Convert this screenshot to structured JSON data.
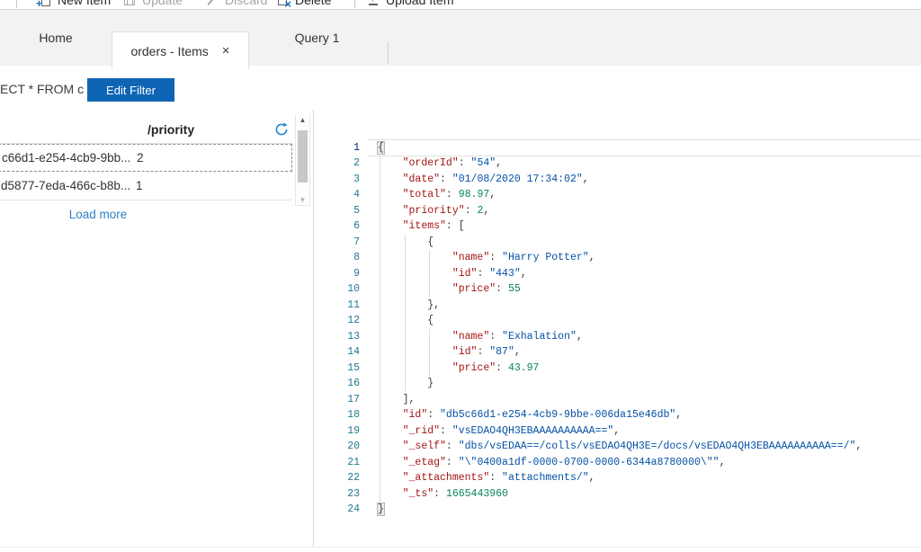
{
  "app": {
    "name": "Azure Cosmos DB Data Explorer"
  },
  "colors": {
    "accent_blue": "#0f65b5",
    "toolbar_icon_blue": "#1170c0",
    "tabbar_background": "#f3f2f1",
    "link_blue": "#2e80c8",
    "json_key": "#a31515",
    "json_string": "#0451a5",
    "json_number": "#098658",
    "line_number": "#237893",
    "active_line_number": "#0b216f"
  },
  "toolbar": {
    "items": [
      {
        "label": "New Item",
        "icon": "new-item-icon",
        "enabled": true
      },
      {
        "label": "Update",
        "icon": "save-icon",
        "enabled": false
      },
      {
        "label": "Discard",
        "icon": "discard-icon",
        "enabled": false
      },
      {
        "label": "Delete",
        "icon": "delete-icon",
        "enabled": true
      },
      {
        "label": "Upload Item",
        "icon": "upload-item-icon",
        "enabled": true
      }
    ]
  },
  "tabs": [
    {
      "label": "Home",
      "active": false,
      "closable": false
    },
    {
      "label": "orders - Items",
      "active": true,
      "closable": true
    },
    {
      "label": "Query 1",
      "active": false,
      "closable": false
    }
  ],
  "icons": {
    "close": "×",
    "scroll_up": "▲",
    "scroll_down": "▼"
  },
  "filter": {
    "query_text": "ECT * FROM c",
    "edit_button_label": "Edit Filter"
  },
  "documents_panel": {
    "column_header": "/priority",
    "rows": [
      {
        "id": "c66d1-e254-4cb9-9bb...",
        "priority": "2",
        "selected": true
      },
      {
        "id": "d5877-7eda-466c-b8b...",
        "priority": "1",
        "selected": false
      }
    ],
    "load_more_label": "Load more"
  },
  "editor": {
    "language": "json",
    "active_line": 1,
    "lines": [
      {
        "n": 1,
        "ind": 0,
        "segs": [
          [
            "p",
            "{",
            1
          ]
        ]
      },
      {
        "n": 2,
        "ind": 4,
        "segs": [
          [
            "k",
            "\"orderId\""
          ],
          [
            "p",
            ": "
          ],
          [
            "s",
            "\"54\""
          ],
          [
            "p",
            ","
          ]
        ]
      },
      {
        "n": 3,
        "ind": 4,
        "segs": [
          [
            "k",
            "\"date\""
          ],
          [
            "p",
            ": "
          ],
          [
            "s",
            "\"01/08/2020 17:34:02\""
          ],
          [
            "p",
            ","
          ]
        ]
      },
      {
        "n": 4,
        "ind": 4,
        "segs": [
          [
            "k",
            "\"total\""
          ],
          [
            "p",
            ": "
          ],
          [
            "n",
            "98.97"
          ],
          [
            "p",
            ","
          ]
        ]
      },
      {
        "n": 5,
        "ind": 4,
        "segs": [
          [
            "k",
            "\"priority\""
          ],
          [
            "p",
            ": "
          ],
          [
            "n",
            "2"
          ],
          [
            "p",
            ","
          ]
        ]
      },
      {
        "n": 6,
        "ind": 4,
        "segs": [
          [
            "k",
            "\"items\""
          ],
          [
            "p",
            ": ["
          ]
        ]
      },
      {
        "n": 7,
        "ind": 8,
        "segs": [
          [
            "p",
            "{"
          ]
        ]
      },
      {
        "n": 8,
        "ind": 12,
        "segs": [
          [
            "k",
            "\"name\""
          ],
          [
            "p",
            ": "
          ],
          [
            "s",
            "\"Harry Potter\""
          ],
          [
            "p",
            ","
          ]
        ]
      },
      {
        "n": 9,
        "ind": 12,
        "segs": [
          [
            "k",
            "\"id\""
          ],
          [
            "p",
            ": "
          ],
          [
            "s",
            "\"443\""
          ],
          [
            "p",
            ","
          ]
        ]
      },
      {
        "n": 10,
        "ind": 12,
        "segs": [
          [
            "k",
            "\"price\""
          ],
          [
            "p",
            ": "
          ],
          [
            "n",
            "55"
          ]
        ]
      },
      {
        "n": 11,
        "ind": 8,
        "segs": [
          [
            "p",
            "},"
          ]
        ]
      },
      {
        "n": 12,
        "ind": 8,
        "segs": [
          [
            "p",
            "{"
          ]
        ]
      },
      {
        "n": 13,
        "ind": 12,
        "segs": [
          [
            "k",
            "\"name\""
          ],
          [
            "p",
            ": "
          ],
          [
            "s",
            "\"Exhalation\""
          ],
          [
            "p",
            ","
          ]
        ]
      },
      {
        "n": 14,
        "ind": 12,
        "segs": [
          [
            "k",
            "\"id\""
          ],
          [
            "p",
            ": "
          ],
          [
            "s",
            "\"87\""
          ],
          [
            "p",
            ","
          ]
        ]
      },
      {
        "n": 15,
        "ind": 12,
        "segs": [
          [
            "k",
            "\"price\""
          ],
          [
            "p",
            ": "
          ],
          [
            "n",
            "43.97"
          ]
        ]
      },
      {
        "n": 16,
        "ind": 8,
        "segs": [
          [
            "p",
            "}"
          ]
        ]
      },
      {
        "n": 17,
        "ind": 4,
        "segs": [
          [
            "p",
            "],"
          ]
        ]
      },
      {
        "n": 18,
        "ind": 4,
        "segs": [
          [
            "k",
            "\"id\""
          ],
          [
            "p",
            ": "
          ],
          [
            "s",
            "\"db5c66d1-e254-4cb9-9bbe-006da15e46db\""
          ],
          [
            "p",
            ","
          ]
        ]
      },
      {
        "n": 19,
        "ind": 4,
        "segs": [
          [
            "k",
            "\"_rid\""
          ],
          [
            "p",
            ": "
          ],
          [
            "s",
            "\"vsEDAO4QH3EBAAAAAAAAAA==\""
          ],
          [
            "p",
            ","
          ]
        ]
      },
      {
        "n": 20,
        "ind": 4,
        "segs": [
          [
            "k",
            "\"_self\""
          ],
          [
            "p",
            ": "
          ],
          [
            "s",
            "\"dbs/vsEDAA==/colls/vsEDAO4QH3E=/docs/vsEDAO4QH3EBAAAAAAAAAA==/\""
          ],
          [
            "p",
            ","
          ]
        ]
      },
      {
        "n": 21,
        "ind": 4,
        "segs": [
          [
            "k",
            "\"_etag\""
          ],
          [
            "p",
            ": "
          ],
          [
            "s",
            "\"\\\"0400a1df-0000-0700-0000-6344a8780000\\\"\""
          ],
          [
            "p",
            ","
          ]
        ]
      },
      {
        "n": 22,
        "ind": 4,
        "segs": [
          [
            "k",
            "\"_attachments\""
          ],
          [
            "p",
            ": "
          ],
          [
            "s",
            "\"attachments/\""
          ],
          [
            "p",
            ","
          ]
        ]
      },
      {
        "n": 23,
        "ind": 4,
        "segs": [
          [
            "k",
            "\"_ts\""
          ],
          [
            "p",
            ": "
          ],
          [
            "n",
            "1665443960"
          ]
        ]
      },
      {
        "n": 24,
        "ind": 0,
        "segs": [
          [
            "p",
            "}",
            1
          ]
        ]
      }
    ]
  }
}
